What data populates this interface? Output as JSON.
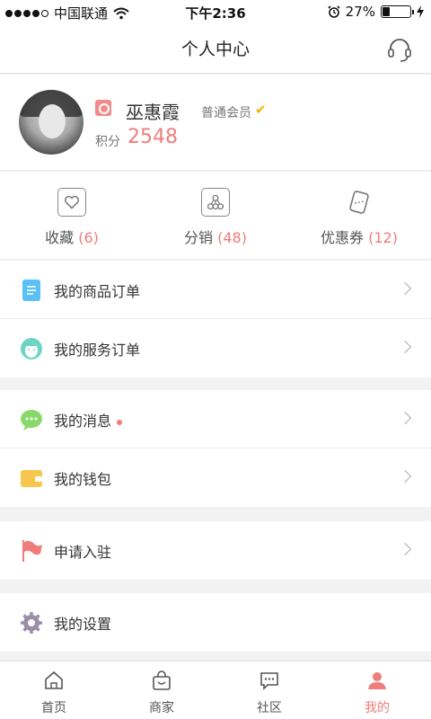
{
  "status_bar": {
    "carrier": "中国联通",
    "time": "下午2:36",
    "battery_pct": "27%",
    "battery_level": 0.27
  },
  "nav": {
    "title": "个人中心",
    "service_icon": "headset-icon"
  },
  "profile": {
    "name": "巫惠霞",
    "member_level": "普通会员",
    "points_label": "积分",
    "points_value": "2548"
  },
  "stats": [
    {
      "label": "收藏",
      "count": "(6)",
      "icon": "heart-icon"
    },
    {
      "label": "分销",
      "count": "(48)",
      "icon": "network-icon"
    },
    {
      "label": "优惠券",
      "count": "(12)",
      "icon": "coupon-icon"
    }
  ],
  "menu": {
    "product_orders": "我的商品订单",
    "service_orders": "我的服务订单",
    "messages": "我的消息",
    "wallet": "我的钱包",
    "apply_join": "申请入驻",
    "settings": "我的设置"
  },
  "tabs": [
    {
      "label": "首页",
      "icon": "home-icon"
    },
    {
      "label": "商家",
      "icon": "shop-bag-icon"
    },
    {
      "label": "社区",
      "icon": "chat-icon"
    },
    {
      "label": "我的",
      "icon": "person-icon"
    }
  ],
  "colors": {
    "accent": "#f07c7c",
    "vip": "#f0b400"
  }
}
